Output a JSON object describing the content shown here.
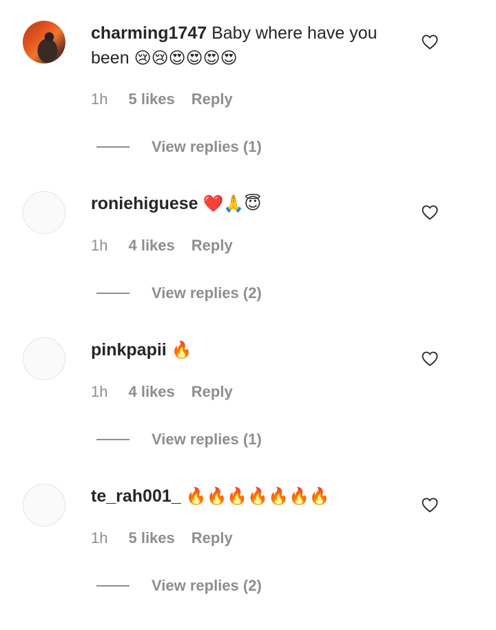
{
  "comments": [
    {
      "username": "charming1747",
      "text": "Baby where have you been",
      "emoji": "😢😢😍😍😍😍",
      "time": "1h",
      "likes": "5 likes",
      "reply_label": "Reply",
      "view_replies": "View replies (1)",
      "avatar": "photo"
    },
    {
      "username": "roniehiguese",
      "text": "",
      "emoji": "❤️🙏😇",
      "time": "1h",
      "likes": "4 likes",
      "reply_label": "Reply",
      "view_replies": "View replies (2)",
      "avatar": "blank"
    },
    {
      "username": "pinkpapii",
      "text": "",
      "emoji": "🔥",
      "time": "1h",
      "likes": "4 likes",
      "reply_label": "Reply",
      "view_replies": "View replies (1)",
      "avatar": "blank"
    },
    {
      "username": "te_rah001_",
      "text": "",
      "emoji": "🔥🔥🔥🔥🔥🔥🔥",
      "time": "1h",
      "likes": "5 likes",
      "reply_label": "Reply",
      "view_replies": "View replies (2)",
      "avatar": "blank"
    }
  ],
  "icons": {
    "like": "heart-outline-icon"
  },
  "colors": {
    "text": "#262626",
    "muted": "#8e8e8e",
    "avatar_border": "#e4e4e4"
  }
}
